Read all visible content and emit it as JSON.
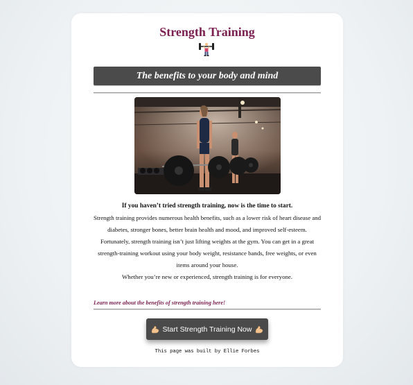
{
  "page": {
    "title": "Strength Training",
    "title_icon": "weightlifter-icon",
    "banner": "The benefits to your body and mind",
    "hero_image": {
      "description_icon": "gym-photo",
      "alt": "Athletes deadlifting barbells in a gym"
    },
    "lead": "If you haven’t tried strength training, now is the time to start.",
    "paragraph1": "Strength training provides numerous health benefits, such as a lower risk of heart disease and diabetes, stronger bones, better brain health and mood, and improved self-esteem.",
    "paragraph2": "Fortunately, strength training isn’t just lifting weights at the gym. You can get in a great strength-training workout using your body weight, resistance bands, free weights, or even items around your house.",
    "paragraph3": "Whether you’re new or experienced, strength training is for everyone.",
    "learn_more": "Learn more about the benefits of strength training here!",
    "cta_label": "Start Strength Training Now",
    "cta_icon": "flexed-biceps-icon",
    "footer": "This page was built by Ellie Forbes"
  },
  "colors": {
    "accent": "#7a1f4f",
    "banner_bg": "#4b4b4b",
    "button_bg": "#4a4a4a",
    "card_bg": "#ffffff"
  }
}
